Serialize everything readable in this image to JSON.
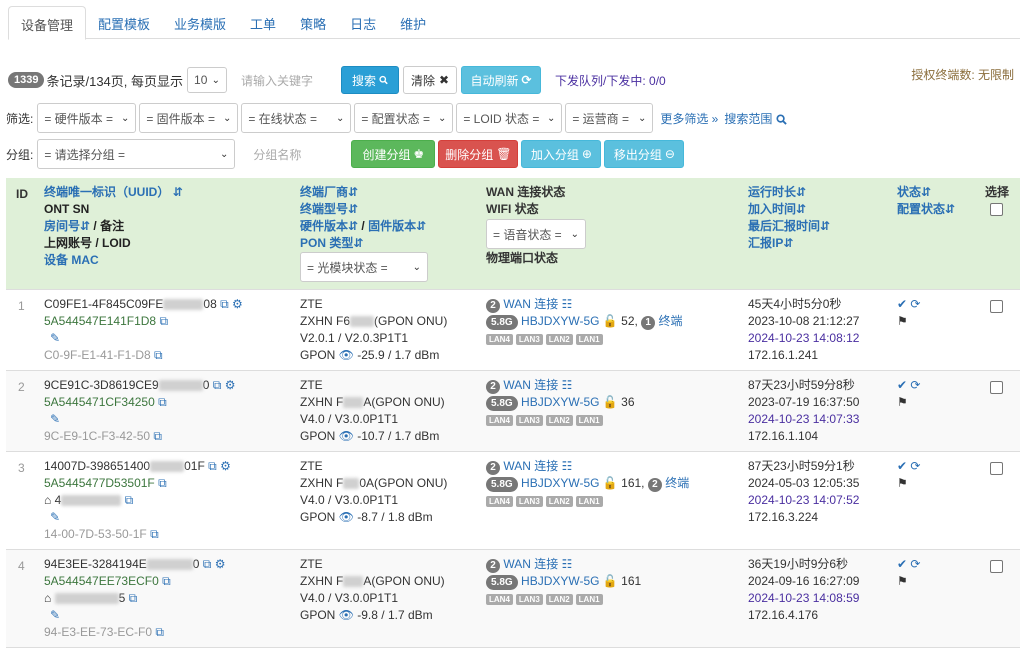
{
  "tabs": [
    "设备管理",
    "配置模板",
    "业务模版",
    "工单",
    "策略",
    "日志",
    "维护"
  ],
  "toolbar": {
    "count": "1339",
    "records_text": "条记录/134页, 每页显示",
    "page_size": "10",
    "search_placeholder": "请输入关键字",
    "search_label": "搜索",
    "clear_label": "清除",
    "autorefresh_label": "自动刷新",
    "queue_text": "下发队列/下发中: 0/0",
    "license_text": "授权终端数: 无限制"
  },
  "filters": {
    "label": "筛选:",
    "selects": [
      "= 硬件版本 =",
      "= 固件版本 =",
      "= 在线状态 =",
      "= 配置状态 =",
      "= LOID 状态 =",
      "= 运营商 ="
    ],
    "more_label": "更多筛选 »",
    "range_label": "搜索范围"
  },
  "group": {
    "label": "分组:",
    "select": "= 请选择分组 =",
    "name_placeholder": "分组名称",
    "create_label": "创建分组",
    "delete_label": "删除分组",
    "join_label": "加入分组",
    "remove_label": "移出分组"
  },
  "header": {
    "id": "ID",
    "col1": [
      "终端唯一标识（UUID）",
      "ONT SN",
      "房间号",
      "/ 备注",
      "上网账号 / LOID",
      "设备 MAC"
    ],
    "col2": [
      "终端厂商",
      "终端型号",
      "硬件版本",
      "/",
      "固件版本",
      "PON 类型"
    ],
    "col2_select": "= 光模块状态 =",
    "col3": [
      "WAN 连接状态",
      "WIFI 状态",
      "物理端口状态"
    ],
    "col3_select": "= 语音状态 =",
    "col4": [
      "运行时长",
      "加入时间",
      "最后汇报时间",
      "汇报IP"
    ],
    "col5": [
      "状态",
      "配置状态"
    ],
    "select": "选择"
  },
  "rows": [
    {
      "id": "1",
      "uuid": "C09FE1-4F845C09FE",
      "uuid_tail": "08",
      "sn": "5A544547E141F1D8",
      "mac": "C0-9F-E1-41-F1-D8",
      "vendor": "ZTE",
      "model_a": "ZXHN F6",
      "model_b": "(GPON ONU)",
      "version": "V2.0.1 / V2.0.3P1T1",
      "pon": "GPON",
      "optic": "-25.9 / 1.7 dBm",
      "wan_count": "2",
      "wan_label": "WAN 连接",
      "wifi_band": "5.8G",
      "ssid": "HBJDXYW-5G",
      "wifi_clients": "52,",
      "term_count": "1",
      "term_label": "终端",
      "ports": [
        "LAN4",
        "LAN3",
        "LAN2",
        "LAN1"
      ],
      "uptime": "45天4小时5分0秒",
      "joined": "2023-10-08 21:12:27",
      "last_report": "2024-10-23 14:08:12",
      "ip": "172.16.1.241"
    },
    {
      "id": "2",
      "uuid": "9CE91C-3D8619CE9",
      "uuid_tail": "0",
      "sn": "5A5445471CF34250",
      "mac": "9C-E9-1C-F3-42-50",
      "vendor": "ZTE",
      "model_a": "ZXHN F",
      "model_b": "A(GPON ONU)",
      "version": "V4.0 / V3.0.0P1T1",
      "pon": "GPON",
      "optic": "-10.7 / 1.7 dBm",
      "wan_count": "2",
      "wan_label": "WAN 连接",
      "wifi_band": "5.8G",
      "ssid": "HBJDXYW-5G",
      "wifi_clients": "36",
      "ports": [
        "LAN4",
        "LAN3",
        "LAN2",
        "LAN1"
      ],
      "uptime": "87天23小时59分8秒",
      "joined": "2023-07-19 16:37:50",
      "last_report": "2024-10-23 14:07:33",
      "ip": "172.16.1.104"
    },
    {
      "id": "3",
      "uuid": "14007D-398651400",
      "uuid_tail": "01F",
      "sn": "5A5445477D53501F",
      "room": "4",
      "mac": "14-00-7D-53-50-1F",
      "vendor": "ZTE",
      "model_a": "ZXHN F",
      "model_b": "0A(GPON ONU)",
      "version": "V4.0 / V3.0.0P1T1",
      "pon": "GPON",
      "optic": "-8.7 / 1.8 dBm",
      "wan_count": "2",
      "wan_label": "WAN 连接",
      "wifi_band": "5.8G",
      "ssid": "HBJDXYW-5G",
      "wifi_clients": "161,",
      "term_count": "2",
      "term_label": "终端",
      "ports": [
        "LAN4",
        "LAN3",
        "LAN2",
        "LAN1"
      ],
      "uptime": "87天23小时59分1秒",
      "joined": "2024-05-03 12:05:35",
      "last_report": "2024-10-23 14:07:52",
      "ip": "172.16.3.224"
    },
    {
      "id": "4",
      "uuid": "94E3EE-3284194E",
      "uuid_tail": "0",
      "sn": "5A544547EE73ECF0",
      "room": "",
      "room_tail": "5",
      "mac": "94-E3-EE-73-EC-F0",
      "vendor": "ZTE",
      "model_a": "ZXHN F",
      "model_b": "A(GPON ONU)",
      "version": "V4.0 / V3.0.0P1T1",
      "pon": "GPON",
      "optic": "-9.8 / 1.7 dBm",
      "wan_count": "2",
      "wan_label": "WAN 连接",
      "wifi_band": "5.8G",
      "ssid": "HBJDXYW-5G",
      "wifi_clients": "161",
      "ports": [
        "LAN4",
        "LAN3",
        "LAN2",
        "LAN1"
      ],
      "uptime": "36天19小时9分6秒",
      "joined": "2024-09-16 16:27:09",
      "last_report": "2024-10-23 14:08:59",
      "ip": "172.16.4.176"
    }
  ]
}
